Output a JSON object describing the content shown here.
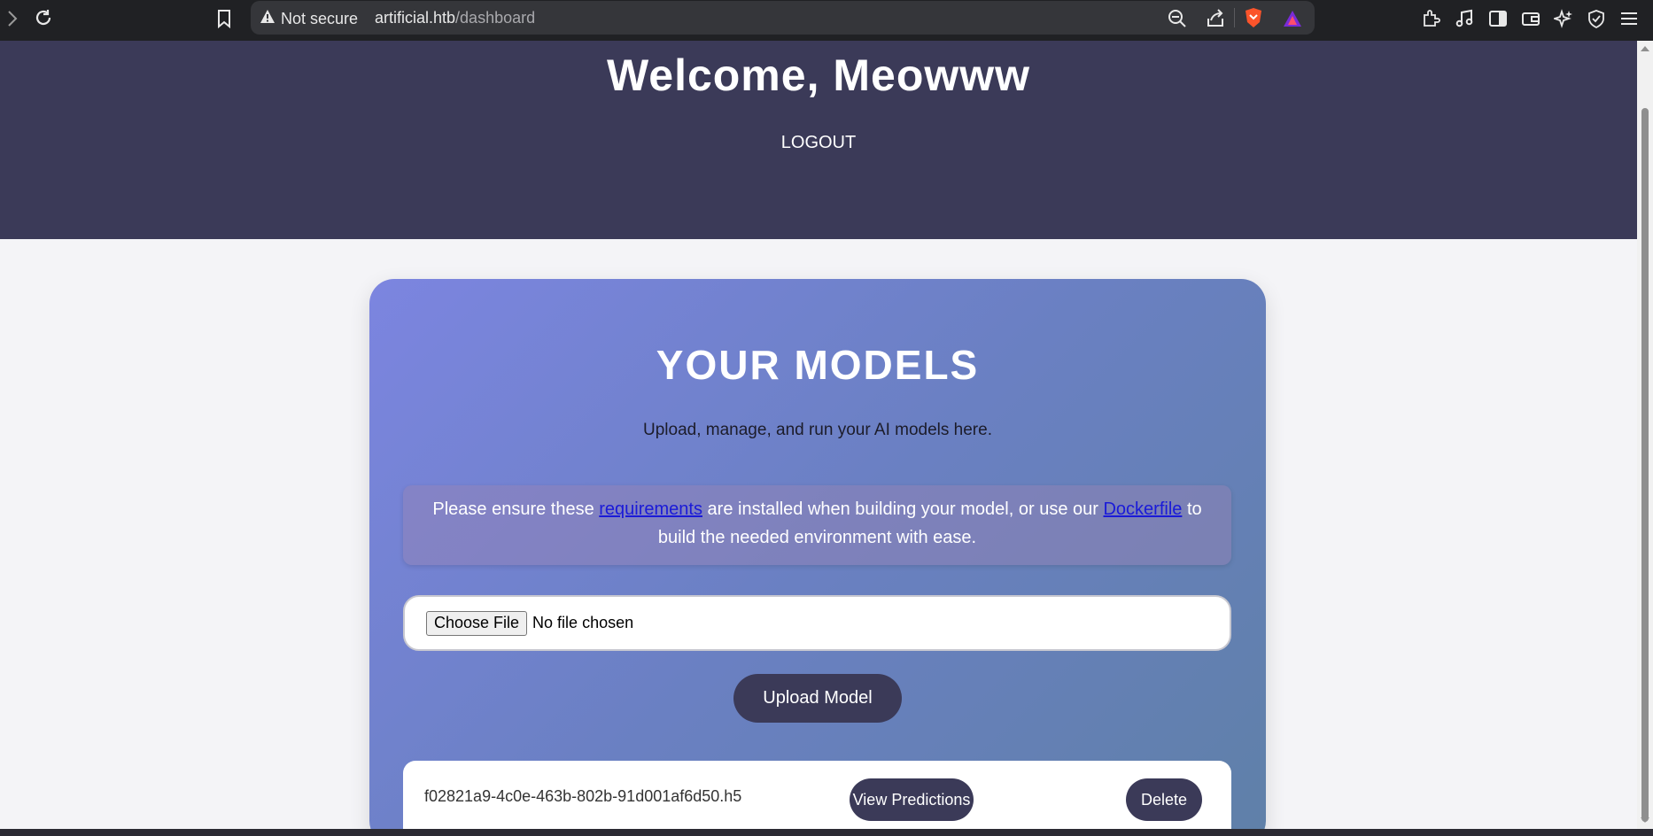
{
  "browser": {
    "security_label": "Not secure",
    "url_host": "artificial.htb",
    "url_path": "/dashboard"
  },
  "header": {
    "welcome": "Welcome, Meowww",
    "logout": "LOGOUT"
  },
  "card": {
    "title": "YOUR MODELS",
    "subtitle": "Upload, manage, and run your AI models here.",
    "notice": {
      "text_1": "Please ensure these ",
      "link_requirements": "requirements",
      "text_2": " are installed when building your model, or use our ",
      "link_dockerfile": "Dockerfile",
      "text_3": " to build the needed environment with ease."
    },
    "file_input": {
      "button": "Choose File",
      "status": "No file chosen"
    },
    "upload_button": "Upload Model",
    "models": [
      {
        "name": "f02821a9-4c0e-463b-802b-91d001af6d50.h5",
        "view_label": "View Predictions",
        "delete_label": "Delete"
      }
    ]
  },
  "colors": {
    "header_bg": "#3b3a58",
    "button_bg": "#3b3a58",
    "link": "#1a1ad8"
  }
}
